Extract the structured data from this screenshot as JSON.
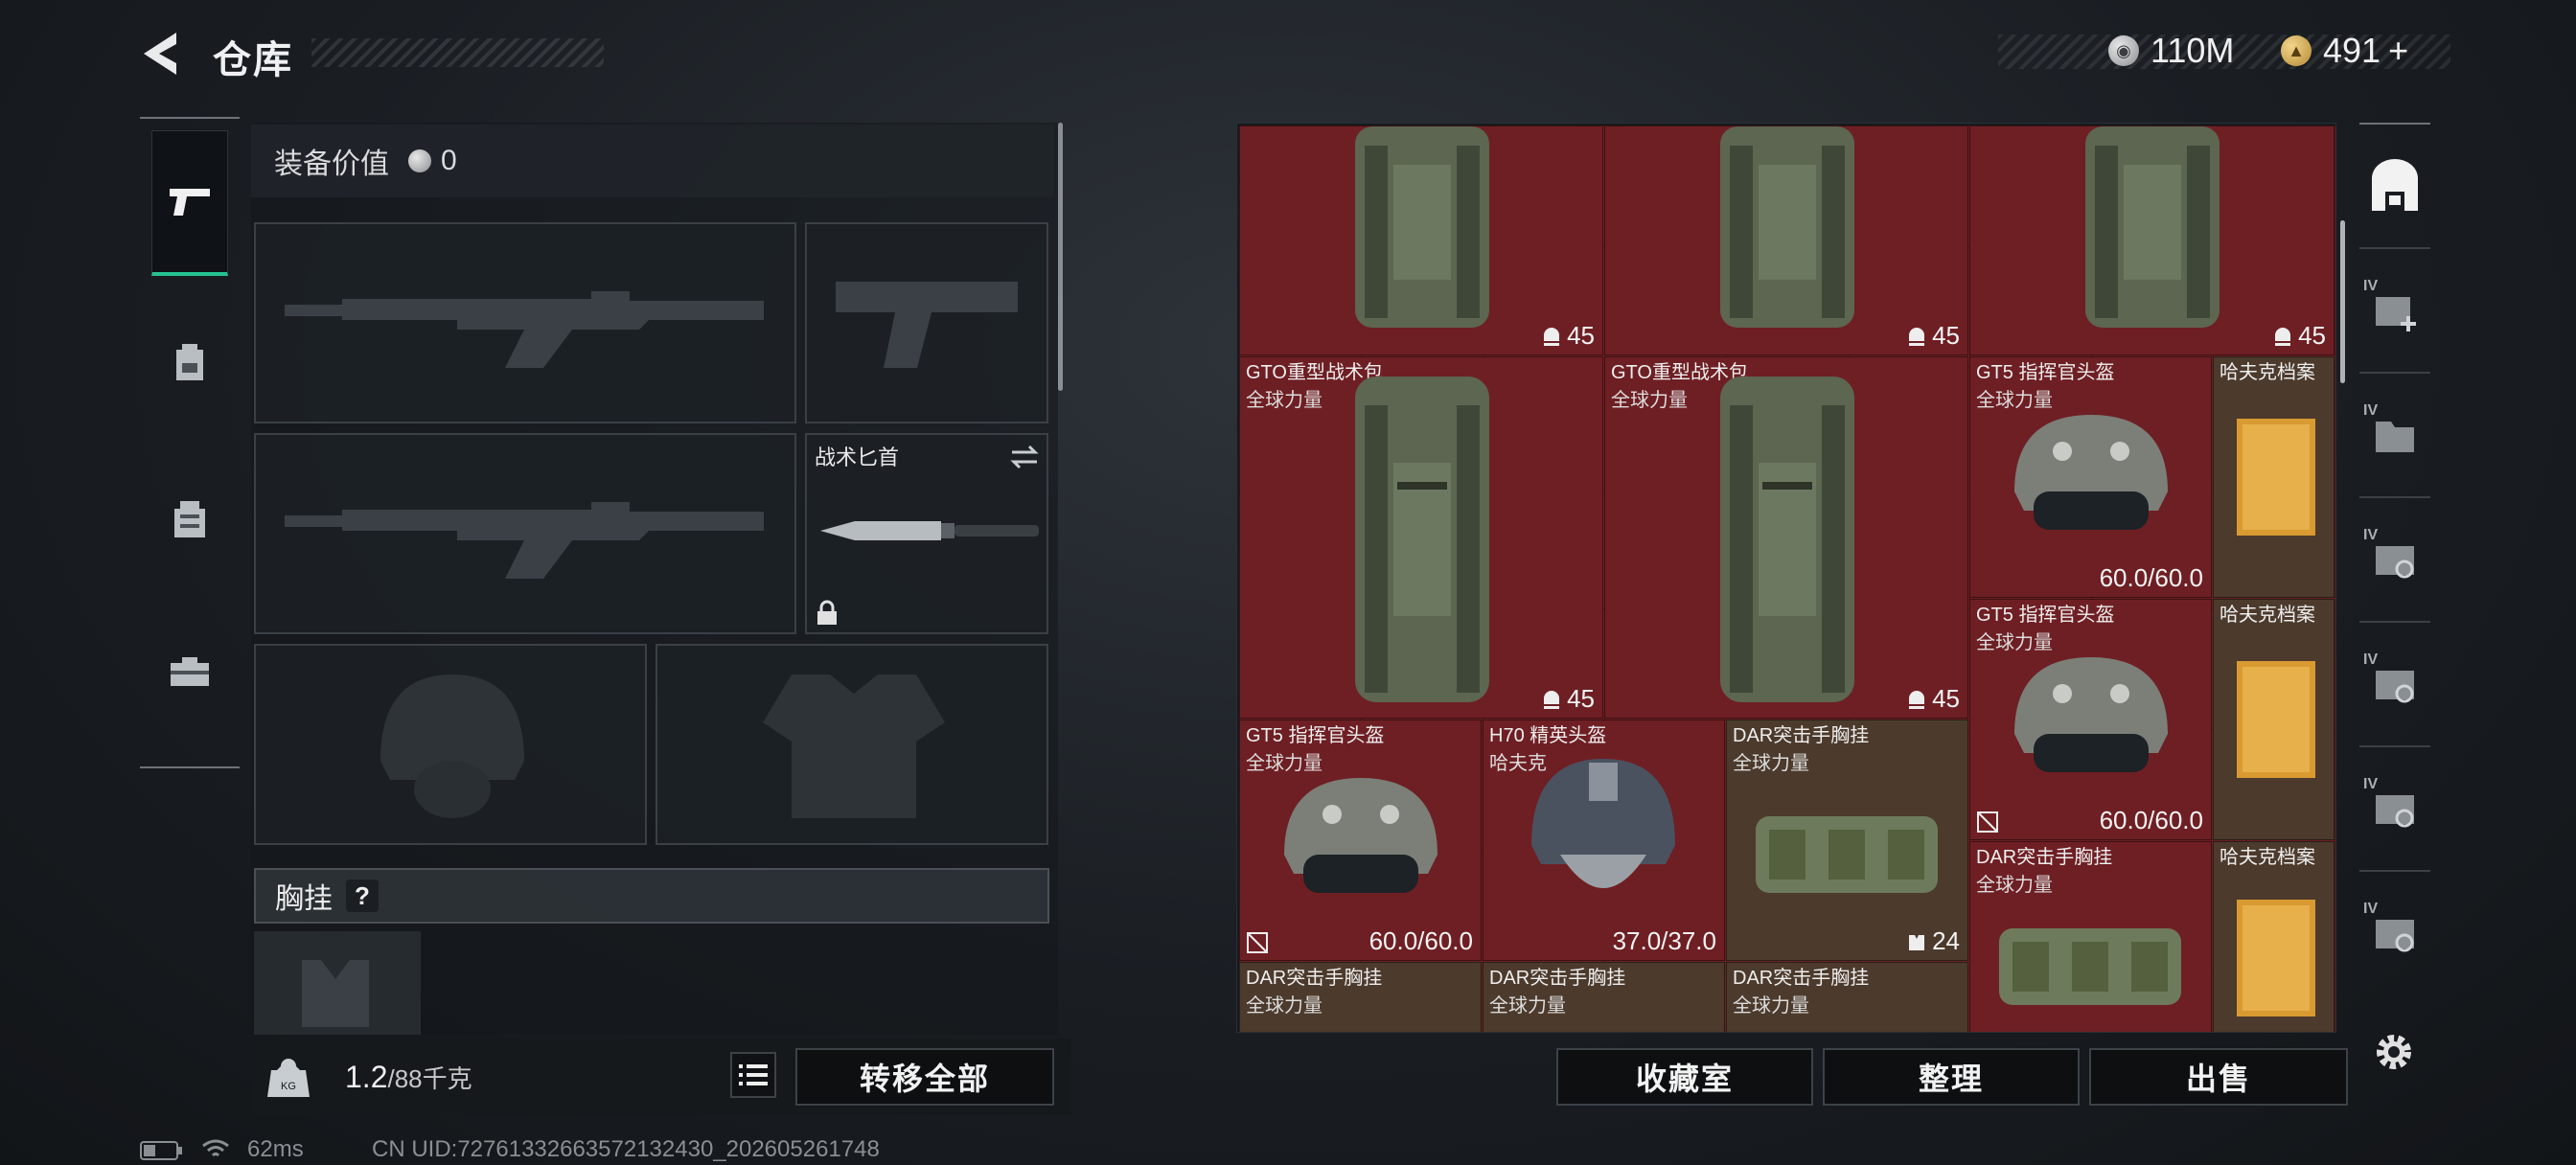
{
  "header": {
    "title": "仓库"
  },
  "currency": {
    "silver": "110M",
    "gold": "491",
    "gold_plus": "+"
  },
  "rail": {
    "items": [
      "pistol-icon",
      "backpack-icon",
      "armor-icon",
      "toolbox-icon"
    ]
  },
  "loadout": {
    "equip_value_label": "装备价值",
    "equip_value": "0",
    "knife_label": "战术匕首",
    "chest_label": "胸挂",
    "chest_help": "?"
  },
  "weight": {
    "current": "1.2",
    "max": "/88千克"
  },
  "buttons": {
    "transfer_all": "转移全部",
    "collection": "收藏室",
    "sort": "整理",
    "sell": "出售"
  },
  "status": {
    "ping": "62ms",
    "uid": "CN UID:7276133266357213243​0_202605261748"
  },
  "stash": {
    "items": [
      {
        "name": "",
        "sub": "",
        "value": "45"
      },
      {
        "name": "",
        "sub": "",
        "value": "45"
      },
      {
        "name": "",
        "sub": "",
        "value": "45"
      },
      {
        "name": "GTO重型战术包",
        "sub": "全球力量",
        "value": "45"
      },
      {
        "name": "GTO重型战术包",
        "sub": "全球力量",
        "value": "45"
      },
      {
        "name": "GT5 指挥官头盔",
        "sub": "全球力量",
        "value": "60.0/60.0"
      },
      {
        "name": "哈夫克档案",
        "sub": "",
        "value": ""
      },
      {
        "name": "GT5 指挥官头盔",
        "sub": "全球力量",
        "value": "60.0/60.0"
      },
      {
        "name": "哈夫克档案",
        "sub": "",
        "value": ""
      },
      {
        "name": "GT5 指挥官头盔",
        "sub": "全球力量",
        "value": "60.0/60.0"
      },
      {
        "name": "H70 精英头盔",
        "sub": "哈夫克",
        "value": "37.0/37.0"
      },
      {
        "name": "DAR突击手胸挂",
        "sub": "全球力量",
        "value": "24"
      },
      {
        "name": "DAR突击手胸挂",
        "sub": "全球力量",
        "value": ""
      },
      {
        "name": "哈夫克档案",
        "sub": "",
        "value": ""
      },
      {
        "name": "DAR突击手胸挂",
        "sub": "全球力量",
        "value": ""
      },
      {
        "name": "DAR突击手胸挂",
        "sub": "全球力量",
        "value": ""
      },
      {
        "name": "DAR突击手胸挂",
        "sub": "全球力量",
        "value": ""
      }
    ]
  },
  "right_tabs": {
    "tag": "IV"
  },
  "colors": {
    "accent": "#25c28f",
    "stash_bg": "#6e1f24",
    "rare_bg": "#4c3a2c"
  }
}
